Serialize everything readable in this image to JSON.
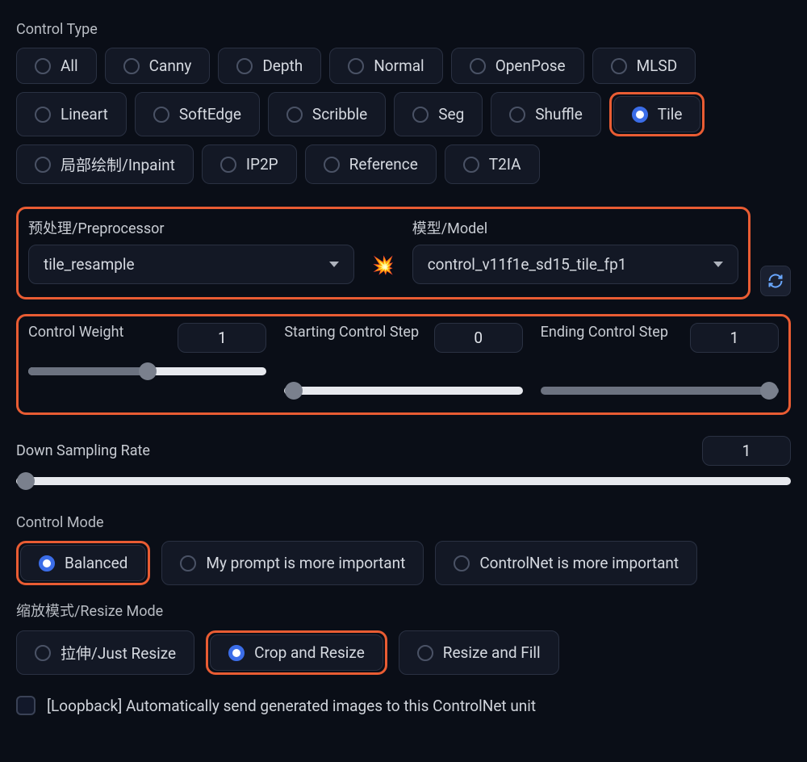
{
  "controlType": {
    "label": "Control Type",
    "options": [
      "All",
      "Canny",
      "Depth",
      "Normal",
      "OpenPose",
      "MLSD",
      "Lineart",
      "SoftEdge",
      "Scribble",
      "Seg",
      "Shuffle",
      "Tile",
      "局部绘制/Inpaint",
      "IP2P",
      "Reference",
      "T2IA"
    ],
    "selected": "Tile"
  },
  "preprocessor": {
    "label": "预处理/Preprocessor",
    "value": "tile_resample"
  },
  "model": {
    "label": "模型/Model",
    "value": "control_v11f1e_sd15_tile_fp1"
  },
  "controlWeight": {
    "label": "Control Weight",
    "value": "1",
    "percent": 50
  },
  "startStep": {
    "label": "Starting Control Step",
    "value": "0",
    "percent": 0
  },
  "endStep": {
    "label": "Ending Control Step",
    "value": "1",
    "percent": 100
  },
  "downSampling": {
    "label": "Down Sampling Rate",
    "value": "1",
    "percent": 0
  },
  "controlMode": {
    "label": "Control Mode",
    "options": [
      "Balanced",
      "My prompt is more important",
      "ControlNet is more important"
    ],
    "selected": "Balanced"
  },
  "resizeMode": {
    "label": "缩放模式/Resize Mode",
    "options": [
      "拉伸/Just Resize",
      "Crop and Resize",
      "Resize and Fill"
    ],
    "selected": "Crop and Resize"
  },
  "loopback": {
    "label": "[Loopback] Automatically send generated images to this ControlNet unit",
    "checked": false
  },
  "icons": {
    "explode": "💥"
  }
}
